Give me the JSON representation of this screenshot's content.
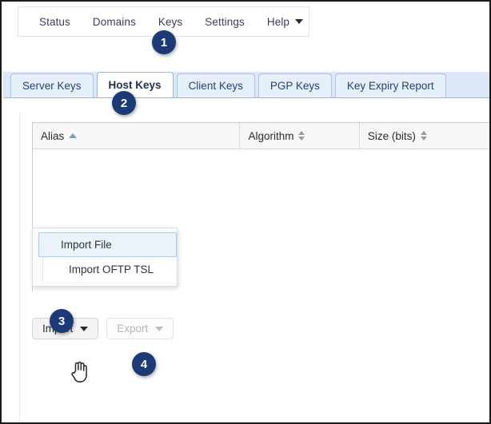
{
  "menubar": {
    "items": [
      {
        "label": "Status",
        "caret": false
      },
      {
        "label": "Domains",
        "caret": false
      },
      {
        "label": "Keys",
        "caret": false
      },
      {
        "label": "Settings",
        "caret": false
      },
      {
        "label": "Help",
        "caret": true
      }
    ]
  },
  "tabs": [
    {
      "label": "Server Keys",
      "active": false
    },
    {
      "label": "Host Keys",
      "active": true
    },
    {
      "label": "Client Keys",
      "active": false
    },
    {
      "label": "PGP Keys",
      "active": false
    },
    {
      "label": "Key Expiry Report",
      "active": false
    }
  ],
  "grid": {
    "columns": [
      {
        "label": "Alias",
        "sort": "asc"
      },
      {
        "label": "Algorithm",
        "sort": "both"
      },
      {
        "label": "Size (bits)",
        "sort": "both"
      }
    ],
    "rows": []
  },
  "toolbar": {
    "import_label": "Import",
    "export_label": "Export"
  },
  "dropdown": {
    "items": [
      {
        "label": "Import File",
        "highlighted": true
      },
      {
        "label": "Import OFTP TSL",
        "highlighted": false
      }
    ]
  },
  "badges": {
    "one": "1",
    "two": "2",
    "three": "3",
    "four": "4"
  },
  "colors": {
    "badge": "#1c3a77",
    "tabstrip": "#dbe8f7",
    "tab_text": "#24427a",
    "grid_border": "#b8d0ea",
    "highlight": "#eaf2fc"
  }
}
